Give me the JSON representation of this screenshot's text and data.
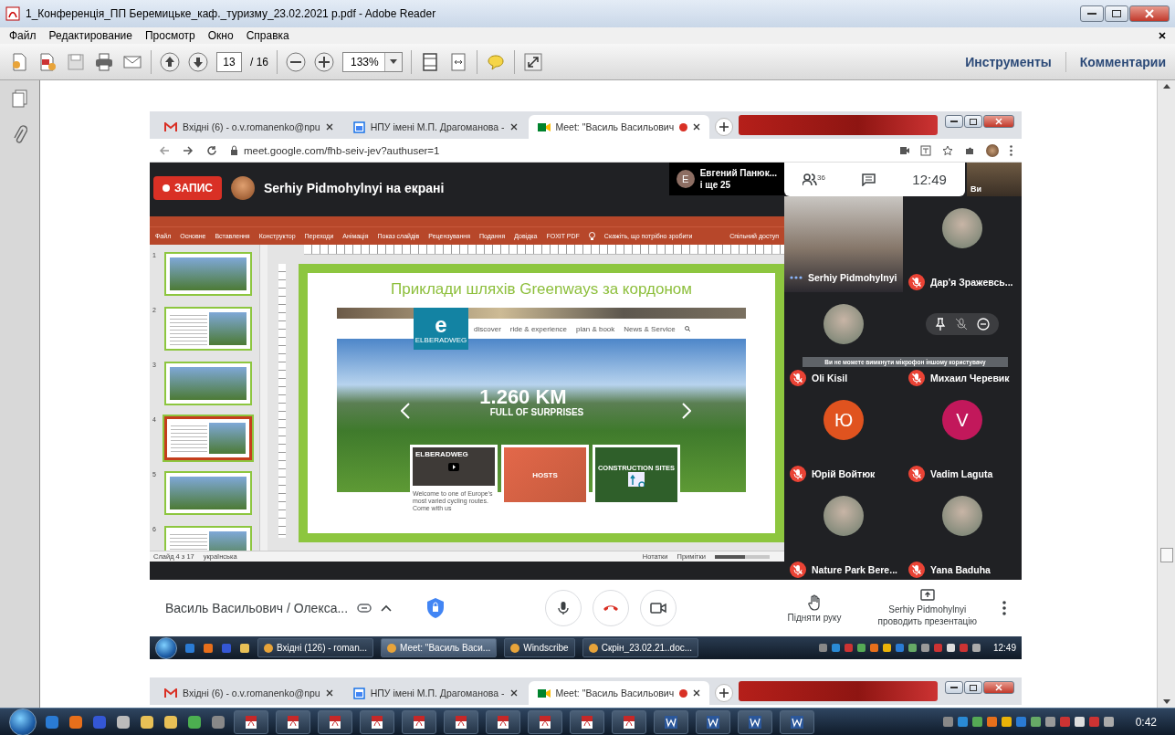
{
  "window": {
    "title": "1_Конференція_ПП Беремицьке_каф._туризму_23.02.2021 р.pdf - Adobe Reader"
  },
  "menu": [
    "Файл",
    "Редактирование",
    "Просмотр",
    "Окно",
    "Справка"
  ],
  "toolbar": {
    "page": "13",
    "page_total": "/ 16",
    "zoom": "133%",
    "tools": "Инструменты",
    "comments": "Комментарии"
  },
  "browser": {
    "tabs": [
      {
        "kind": "mail",
        "label": "Вхідні (6) - o.v.romanenko@npu",
        "selected": false
      },
      {
        "kind": "calendar",
        "label": "НПУ імені М.П. Драгоманова -",
        "selected": false
      },
      {
        "kind": "meet",
        "label": "Meet: \"Василь Васильович",
        "selected": true
      }
    ],
    "url": "meet.google.com/fhb-seiv-jev?authuser=1"
  },
  "meet": {
    "record": "ЗАПИС",
    "presenter": "Serhiy Pidmohylnyi на екрані",
    "others": {
      "letter": "Е",
      "name": "Евгений Панюк...",
      "more": "і ще 25"
    },
    "people_count": "36",
    "time": "12:49",
    "self_label": "Ви",
    "participants": [
      {
        "kind": "video",
        "name": "Serhiy Pidmohylnyi",
        "muted": false
      },
      {
        "kind": "photo",
        "name": "Дар'я Зражевсь...",
        "muted": true
      },
      {
        "kind": "photo",
        "name": "Oli Kisil",
        "muted": true
      },
      {
        "kind": "hover",
        "name": "Михаил Черевик",
        "muted": true
      },
      {
        "kind": "letter",
        "letter": "Ю",
        "color": "#e0531f",
        "name": "Юрій Войтюк",
        "muted": true
      },
      {
        "kind": "letter",
        "letter": "V",
        "color": "#c2185b",
        "name": "Vadim Laguta",
        "muted": true
      },
      {
        "kind": "photo",
        "name": "Nature Park Bere...",
        "muted": true
      },
      {
        "kind": "photo",
        "name": "Yana Baduha",
        "muted": true
      }
    ],
    "tooltip": "Ви не можете вимкнути мікрофон іншому користувачу",
    "meeting_name": "Василь Васильович / Олекса...",
    "raise_hand": "Підняти руку",
    "presenting": [
      "Serhiy Pidmohylnyi",
      "проводить презентацію"
    ]
  },
  "presentation": {
    "menu": [
      "Файл",
      "Основне",
      "Вставлення",
      "Конструктор",
      "Переходи",
      "Анімація",
      "Показ слайдів",
      "Рецензування",
      "Подання",
      "Довідка",
      "FOXIT PDF"
    ],
    "tell_me": "Скажіть, що потрібно зробити",
    "share": "Спільний доступ",
    "thumbnails": [
      {
        "number": "1",
        "selected": false
      },
      {
        "number": "2",
        "selected": false
      },
      {
        "number": "3",
        "selected": false
      },
      {
        "number": "4",
        "selected": true
      },
      {
        "number": "5",
        "selected": false
      },
      {
        "number": "6",
        "selected": false
      }
    ],
    "slide": {
      "title": "Приклади шляхів Greenways за кордоном",
      "logo_letter": "e",
      "logo_text": "ELBERADWEG",
      "nav": [
        "discover",
        "ride & experience",
        "plan & book",
        "News & Service"
      ],
      "headline": "1.260 KM",
      "tagline": "FULL OF SURPRISES",
      "cards": [
        {
          "kind": "video",
          "label": "ELBERADWEG",
          "caption": "Welcome to one of Europe's most varied cycling routes. Come with us"
        },
        {
          "kind": "hosts",
          "label": "HOSTS"
        },
        {
          "kind": "construction",
          "label": "CONSTRUCTION SITES"
        }
      ]
    },
    "status": {
      "slide": "Слайд 4 з 17",
      "language": "українська",
      "notes": "Нотатки",
      "comments": "Примітки",
      "zoom_slider": {
        "level": 0.55
      }
    }
  },
  "inner_taskbar": {
    "items": [
      {
        "label": "Вхідні (126) - roman...",
        "selected": false
      },
      {
        "label": "Meet: \"Василь Васи...",
        "selected": true
      },
      {
        "label": "Windscribe",
        "selected": false
      },
      {
        "label": "Скрін_23.02.21..doc...",
        "selected": false
      }
    ],
    "time": "12:49"
  },
  "second_screenshot": {
    "tabs": [
      {
        "kind": "mail",
        "label": "Вхідні (6) - o.v.romanenko@npu",
        "selected": false
      },
      {
        "kind": "calendar",
        "label": "НПУ імені М.П. Драгоманова -",
        "selected": false
      },
      {
        "kind": "meet",
        "label": "Meet: \"Василь Васильович",
        "selected": true
      }
    ]
  },
  "taskbar": {
    "time": "0:42"
  }
}
